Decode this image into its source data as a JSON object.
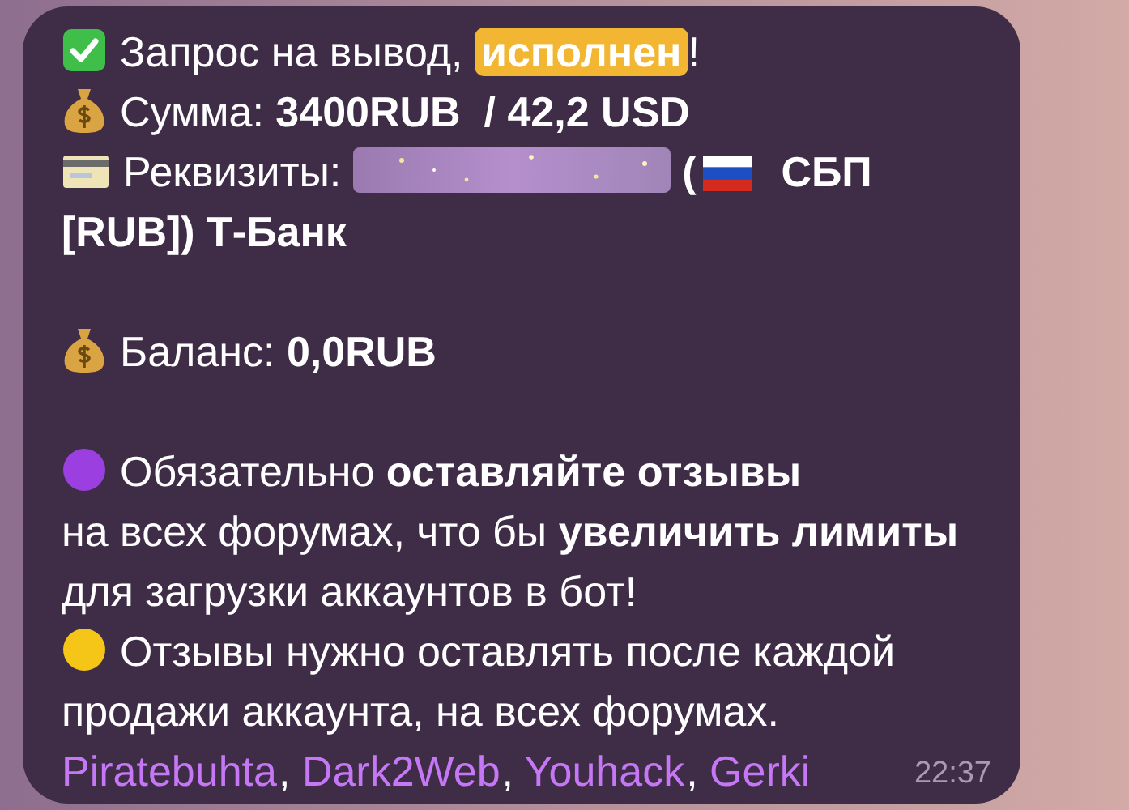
{
  "message": {
    "paragraphs": [
      {
        "lines": [
          [
            {
              "kind": "check"
            },
            {
              "kind": "text",
              "text": "Запрос на вывод, "
            },
            {
              "kind": "highlight",
              "text": "исполнен"
            },
            {
              "kind": "text",
              "text": "!"
            }
          ],
          [
            {
              "kind": "money"
            },
            {
              "kind": "text",
              "text": "Сумма: **3400RUB  / 42,2 USD**"
            }
          ],
          [
            {
              "kind": "card"
            },
            {
              "kind": "text",
              "text": "Реквизиты: "
            },
            {
              "kind": "spoiler"
            },
            {
              "kind": "bold",
              "text": " ("
            },
            {
              "kind": "flag"
            },
            {
              "kind": "bold",
              "text": "  СБП"
            }
          ],
          [
            {
              "kind": "bold",
              "text": "[RUB]) Т-Банк"
            }
          ]
        ]
      },
      {
        "lines": [
          [
            {
              "kind": "money"
            },
            {
              "kind": "text",
              "text": "Баланс: **0,0RUB**"
            }
          ]
        ]
      },
      {
        "lines": [
          [
            {
              "kind": "dot",
              "color": "#9b3fe0"
            },
            {
              "kind": "text",
              "text": "Обязательно **оставляйте отзывы**"
            }
          ],
          [
            {
              "kind": "text",
              "text": "на всех форумах, что бы **увеличить лимиты**"
            }
          ],
          [
            {
              "kind": "text",
              "text": "для загрузки аккаунтов в бот!"
            }
          ],
          [
            {
              "kind": "dot",
              "color": "#f5c518"
            },
            {
              "kind": "text",
              "text": "Отзывы нужно оставлять после каждой"
            }
          ],
          [
            {
              "kind": "text",
              "text": "продажи аккаунта, на всех форумах."
            }
          ],
          [
            {
              "kind": "link",
              "text": "Piratebuhta",
              "suffix": ", "
            },
            {
              "kind": "link",
              "text": "Dark2Web",
              "suffix": ", "
            },
            {
              "kind": "link",
              "text": "Youhack",
              "suffix": ", "
            },
            {
              "kind": "link",
              "text": "Gerki"
            }
          ]
        ]
      }
    ],
    "time": "22:37"
  }
}
